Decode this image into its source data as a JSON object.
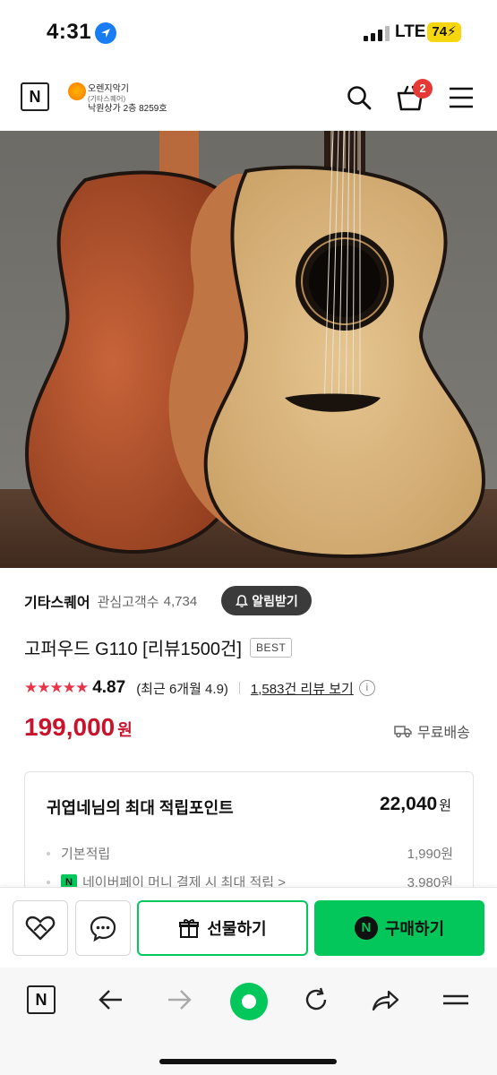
{
  "status_bar": {
    "time": "4:31",
    "network": "LTE",
    "battery": "74"
  },
  "header": {
    "n_logo": "N",
    "shop_name_line1": "오렌지악기",
    "shop_name_line2": "(기타스퀘어)",
    "shop_name_line3": "낙원상가 2층 8259호",
    "cart_count": "2",
    "icons": [
      "search-icon",
      "cart-icon",
      "menu-icon"
    ]
  },
  "store": {
    "name": "기타스퀘어",
    "follow_label": "관심고객수",
    "follow_count": "4,734",
    "alarm_label": "알림받기"
  },
  "product": {
    "title": "고퍼우드 G110 [리뷰1500건]",
    "badge": "BEST",
    "rating": "4.87",
    "stars": 5,
    "recent_rating": "(최근 6개월 4.9)",
    "review_link": "1,583건 리뷰 보기",
    "price": "199,000",
    "currency": "원",
    "shipping": "무료배송"
  },
  "points": {
    "title": "귀엽네님의 최대 적립포인트",
    "total": "22,040",
    "unit": "원",
    "lines": [
      {
        "label": "기본적립",
        "amount": "1,990원"
      },
      {
        "label": "네이버페이 머니 결제 시 최대 적립 >",
        "amount": "3,980원"
      }
    ]
  },
  "purchase_bar": {
    "gift_label": "선물하기",
    "buy_label": "구매하기",
    "buy_icon": "N"
  },
  "browser_bar": {
    "n_logo": "N",
    "icons": [
      "back-icon",
      "forward-icon",
      "home-icon",
      "refresh-icon",
      "share-icon",
      "menu-icon"
    ]
  },
  "colors": {
    "accent": "#03c75a",
    "price": "#c9132b",
    "stars": "#e8354a"
  }
}
